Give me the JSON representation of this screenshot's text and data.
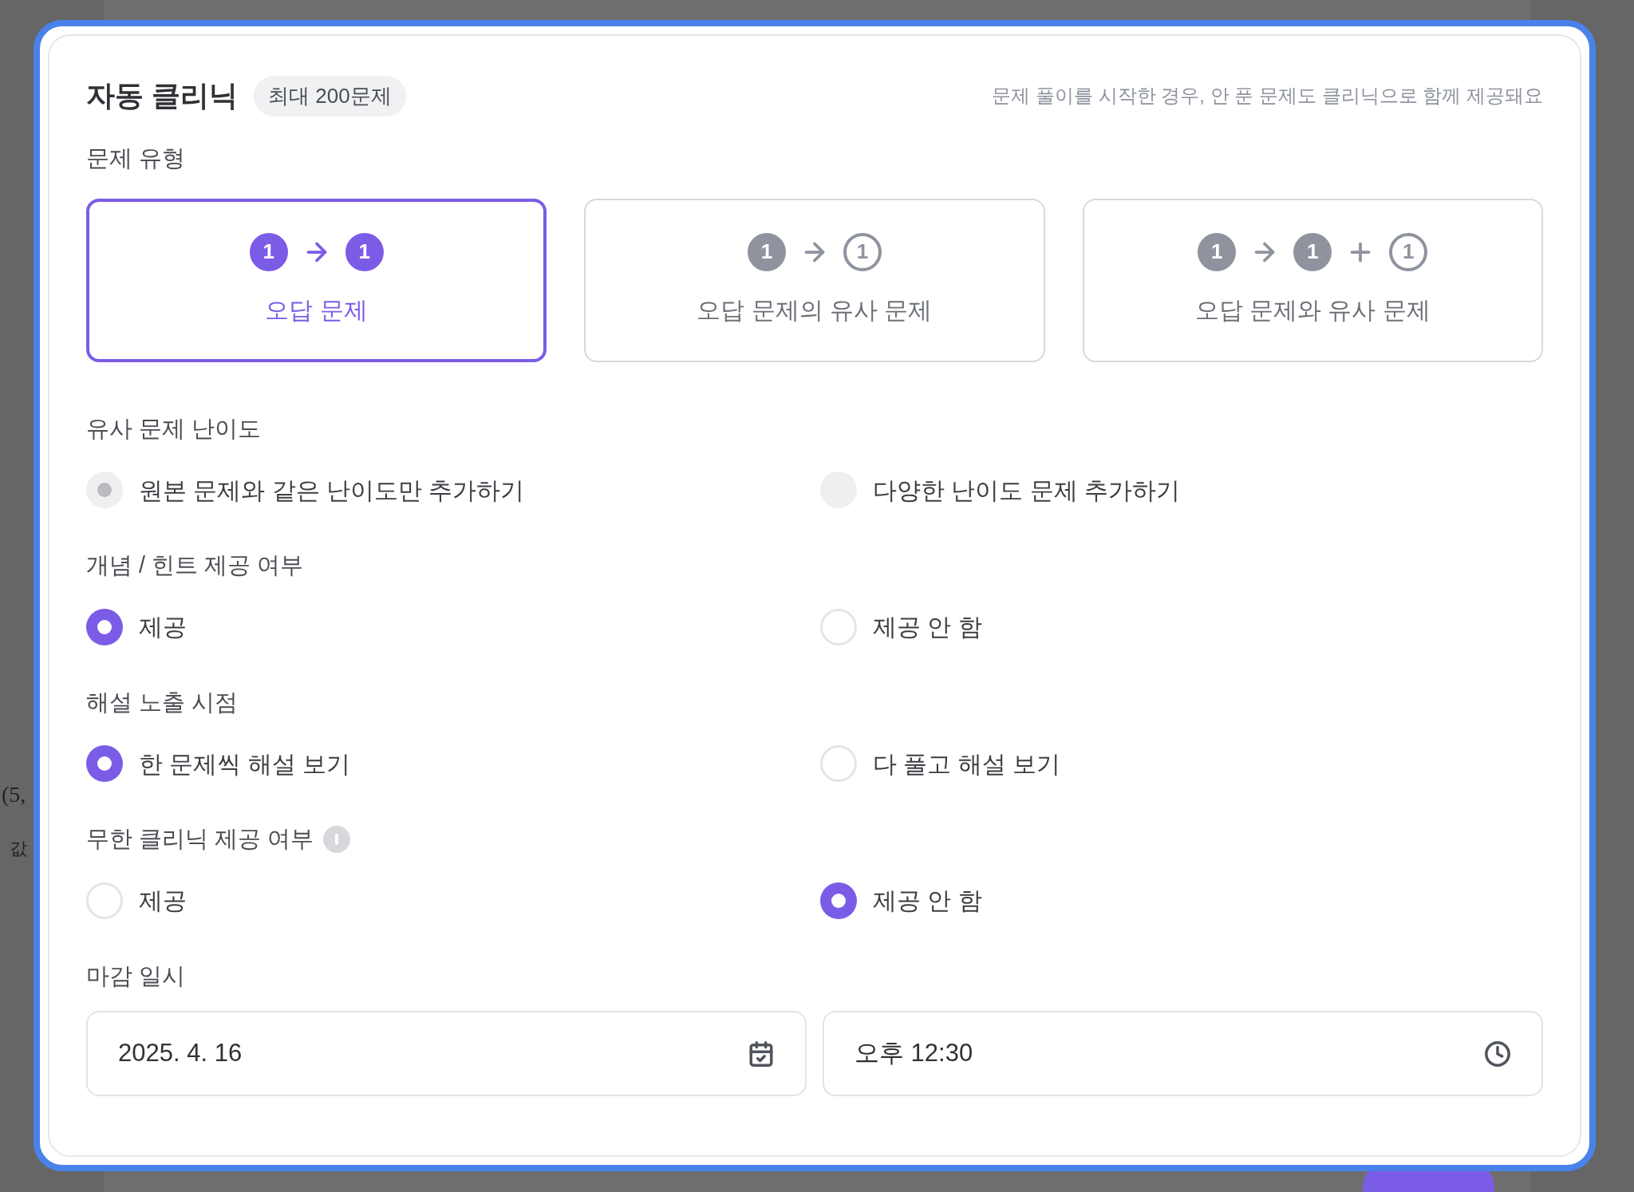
{
  "backdrop": {
    "texts": [
      "(5,",
      "값"
    ]
  },
  "panel": {
    "title": "자동 클리닉",
    "badge": "최대 200문제",
    "note": "문제 풀이를 시작한 경우, 안 푼 문제도 클리닉으로 함께 제공돼요"
  },
  "problem_type": {
    "label": "문제 유형",
    "options": [
      {
        "label": "오답 문제",
        "selected": true,
        "diagram": [
          {
            "kind": "filled",
            "text": "1"
          },
          {
            "kind": "arrow"
          },
          {
            "kind": "filled",
            "text": "1"
          }
        ]
      },
      {
        "label": "오답 문제의 유사 문제",
        "selected": false,
        "diagram": [
          {
            "kind": "filled",
            "text": "1"
          },
          {
            "kind": "arrow"
          },
          {
            "kind": "outline",
            "text": "1"
          }
        ]
      },
      {
        "label": "오답 문제와 유사 문제",
        "selected": false,
        "diagram": [
          {
            "kind": "filled",
            "text": "1"
          },
          {
            "kind": "arrow"
          },
          {
            "kind": "filled",
            "text": "1"
          },
          {
            "kind": "plus"
          },
          {
            "kind": "outline",
            "text": "1"
          }
        ]
      }
    ]
  },
  "groups": [
    {
      "label": "유사 문제 난이도",
      "info": false,
      "options": [
        {
          "label": "원본 문제와 같은 난이도만 추가하기",
          "selected": true,
          "disabled": true
        },
        {
          "label": "다양한 난이도 문제 추가하기",
          "selected": false,
          "disabled": true
        }
      ]
    },
    {
      "label": "개념 / 힌트 제공 여부",
      "info": false,
      "options": [
        {
          "label": "제공",
          "selected": true,
          "disabled": false
        },
        {
          "label": "제공 안 함",
          "selected": false,
          "disabled": false
        }
      ]
    },
    {
      "label": "해설 노출 시점",
      "info": false,
      "options": [
        {
          "label": "한 문제씩 해설 보기",
          "selected": true,
          "disabled": false
        },
        {
          "label": "다 풀고 해설 보기",
          "selected": false,
          "disabled": false
        }
      ]
    },
    {
      "label": "무한 클리닉 제공 여부",
      "info": true,
      "options": [
        {
          "label": "제공",
          "selected": false,
          "disabled": false
        },
        {
          "label": "제공 안 함",
          "selected": true,
          "disabled": false
        }
      ]
    }
  ],
  "deadline": {
    "label": "마감 일시",
    "date": "2025. 4. 16",
    "time": "오후 12:30"
  }
}
